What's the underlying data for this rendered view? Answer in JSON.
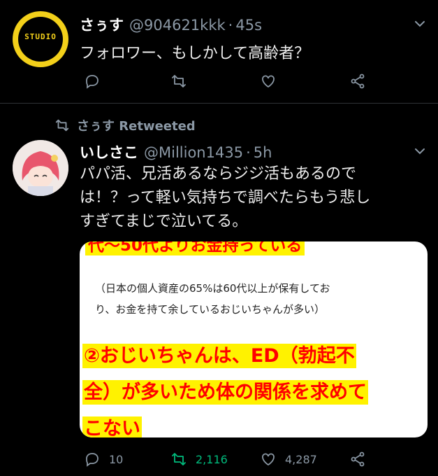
{
  "tweet1": {
    "display_name": "さぅす",
    "handle": "@904621kkk",
    "separator": "·",
    "time": "45s",
    "text": "フォロワー、もしかして高齢者？",
    "avatar_label": "STUDIO"
  },
  "retweet_banner": {
    "label": "さぅす Retweeted"
  },
  "tweet2": {
    "display_name": "いしさこ",
    "handle": "@Million1435",
    "separator": "·",
    "time": "5h",
    "text_lines": [
      "パパ活、兄活あるならジジ活もあるので",
      "は！？って軽い気持ちで調べたらもう悲し",
      "すぎてまじで泣いてる。"
    ],
    "image_card": {
      "top_partial": "代〜50代よりお金持っている",
      "note_line1": "（日本の個人資産の65%は60代以上が保有してお",
      "note_line2": "り、お金を持て余しているおじいちゃんが多い）",
      "big_line1": "②おじいちゃんは、ED（勃起不",
      "big_line2": "全）が多いため体の関係を求めて",
      "big_line3": "こない"
    },
    "stats": {
      "replies": "10",
      "retweets": "2,116",
      "likes": "4,287"
    }
  },
  "colors": {
    "background": "#000000",
    "muted": "#8b98a5",
    "retweet_active": "#00ba7c",
    "highlight_bg": "#fff200",
    "highlight_text": "#ff0000"
  },
  "icons": [
    "reply-icon",
    "retweet-icon",
    "like-icon",
    "share-icon",
    "chevron-down-icon"
  ]
}
